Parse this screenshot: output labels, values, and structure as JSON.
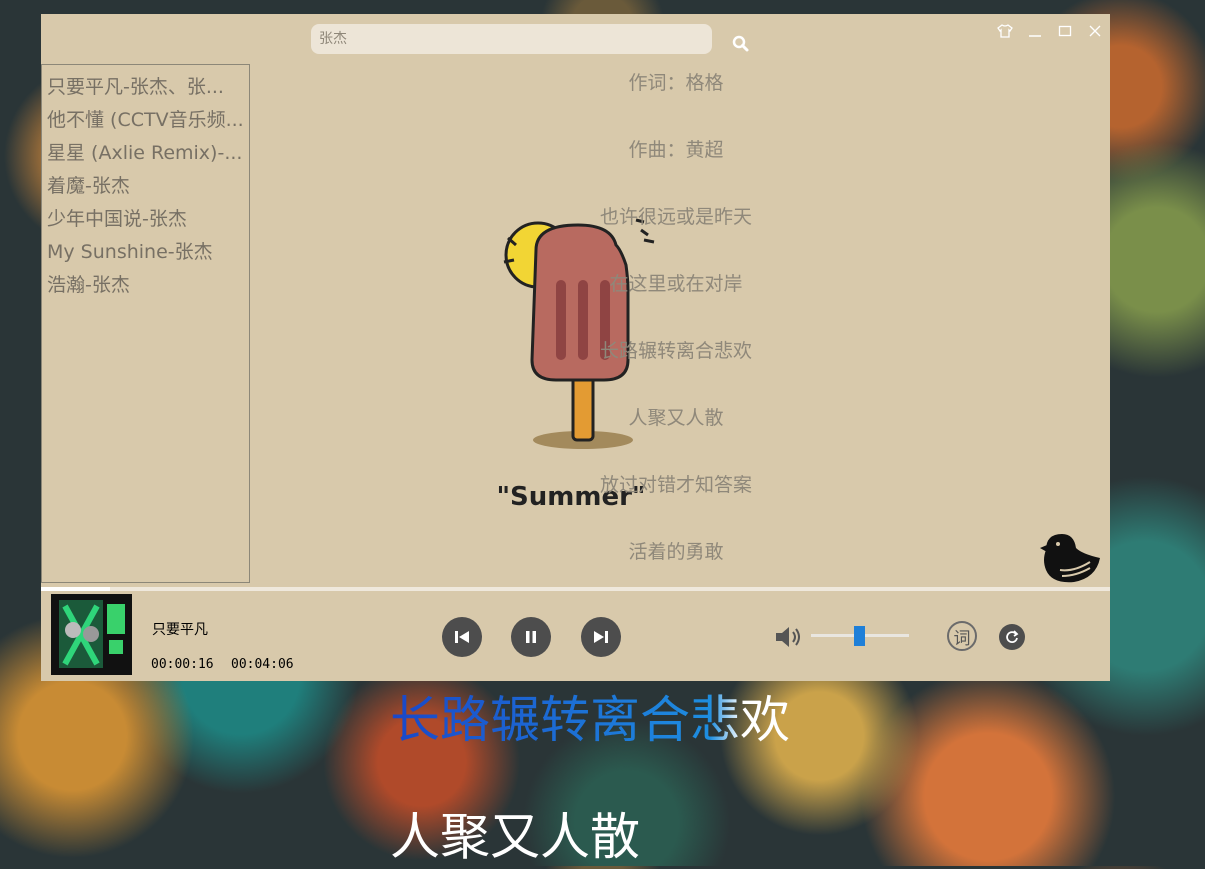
{
  "search": {
    "value": "张杰"
  },
  "playlist": [
    "只要平凡-张杰、张...",
    "他不懂 (CCTV音乐频...",
    "星星 (Axlie Remix)-...",
    "着魔-张杰",
    "少年中国说-张杰",
    "My Sunshine-张杰",
    "浩瀚-张杰"
  ],
  "lyrics": [
    "作词：格格",
    "作曲：黄超",
    "也许很远或是昨天",
    "在这里或在对岸",
    "长路辗转离合悲欢",
    "人聚又人散",
    "放过对错才知答案",
    "活着的勇敢"
  ],
  "artwork": {
    "text": "\"Summer\""
  },
  "player": {
    "title": "只要平凡",
    "current_time": "00:00:16",
    "total_time": "00:04:06",
    "progress": 0.065,
    "volume": 0.5,
    "lyric_button": "词"
  },
  "desktop_lyrics": {
    "current": "长路辗转离合悲欢",
    "next": "人聚又人散"
  },
  "colors": {
    "window_bg": "#d8c9ab",
    "accent": "#1e7fd8",
    "button": "#4d4d4d"
  }
}
